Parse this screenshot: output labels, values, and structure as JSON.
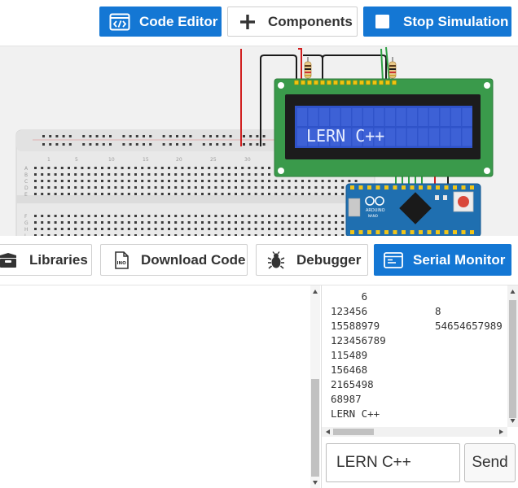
{
  "toolbar": {
    "code_editor_label": "Code Editor",
    "components_label": "Components",
    "stop_simulation_label": "Stop Simulation"
  },
  "circuit": {
    "lcd_text": "LERN C++",
    "arduino_brand": "ARDUINO",
    "arduino_model": "NANO",
    "breadboard_numbers": [
      "1",
      "5",
      "10",
      "15",
      "20",
      "25",
      "30"
    ],
    "breadboard_rows_top": [
      "A",
      "B",
      "C",
      "D",
      "E"
    ],
    "breadboard_rows_bottom": [
      "F",
      "G",
      "H",
      "I",
      "J"
    ]
  },
  "bottom_toolbar": {
    "libraries_label": "Libraries",
    "download_label": "Download Code",
    "debugger_label": "Debugger",
    "serial_monitor_label": "Serial Monitor"
  },
  "serial_monitor": {
    "lines": [
      {
        "left": "     6",
        "right": ""
      },
      {
        "left": "123456",
        "right": "8"
      },
      {
        "left": "15588979",
        "right": "54654657989"
      },
      {
        "left": "123456789",
        "right": ""
      },
      {
        "left": "115489",
        "right": ""
      },
      {
        "left": "156468",
        "right": ""
      },
      {
        "left": "2165498",
        "right": ""
      },
      {
        "left": "68987",
        "right": ""
      },
      {
        "left": "LERN C++",
        "right": ""
      }
    ],
    "input_value": "LERN C++",
    "send_label": "Send"
  },
  "colors": {
    "accent": "#1477d4",
    "lcd_board": "#3a9a4b",
    "lcd_screen": "#2f53c9",
    "arduino_board": "#1f6fb0"
  }
}
